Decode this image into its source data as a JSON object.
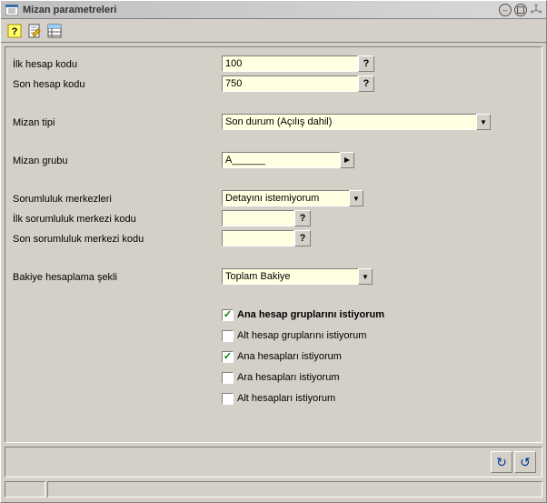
{
  "window": {
    "title": "Mizan parametreleri"
  },
  "form": {
    "ilk_hesap_kodu": {
      "label": "İlk hesap kodu",
      "value": "100"
    },
    "son_hesap_kodu": {
      "label": "Son hesap kodu",
      "value": "750"
    },
    "mizan_tipi": {
      "label": "Mizan tipi",
      "value": "Son durum (Açılış dahil)"
    },
    "mizan_grubu": {
      "label": "Mizan grubu",
      "value": "A______"
    },
    "sorumluluk_merkezleri": {
      "label": "Sorumluluk merkezleri",
      "value": "Detayını istemiyorum"
    },
    "ilk_sorumluluk": {
      "label": "İlk sorumluluk merkezi kodu",
      "value": ""
    },
    "son_sorumluluk": {
      "label": "Son sorumluluk merkezi kodu",
      "value": ""
    },
    "bakiye_sekli": {
      "label": "Bakiye hesaplama şekli",
      "value": "Toplam Bakiye"
    }
  },
  "checks": {
    "ana_hesap_gruplari": {
      "label": "Ana hesap gruplarını istiyorum",
      "checked": true,
      "bold": true
    },
    "alt_hesap_gruplari": {
      "label": "Alt hesap gruplarını istiyorum",
      "checked": false,
      "bold": false
    },
    "ana_hesaplari": {
      "label": "Ana hesapları istiyorum",
      "checked": true,
      "bold": false
    },
    "ara_hesaplari": {
      "label": "Ara hesapları istiyorum",
      "checked": false,
      "bold": false
    },
    "alt_hesaplari": {
      "label": "Alt hesapları istiyorum",
      "checked": false,
      "bold": false
    }
  },
  "glyphs": {
    "help": "?",
    "dropdown": "▼",
    "refresh_cw": "↻",
    "refresh_ccw": "↺",
    "minimize": "–"
  }
}
